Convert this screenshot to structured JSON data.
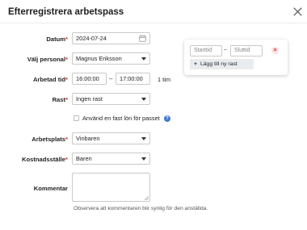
{
  "dialog": {
    "title": "Efterregistrera arbetspass",
    "close_icon": "close-icon"
  },
  "form": {
    "datum": {
      "label": "Datum",
      "required_mark": "*",
      "value": "2024-07-24",
      "icon": "calendar-icon"
    },
    "personal": {
      "label": "Välj personal",
      "required_mark": "*",
      "value": "Magnus Eriksson"
    },
    "arbetad_tid": {
      "label": "Arbetad tid",
      "required_mark": "*",
      "start": "16:00:00",
      "separator": "–",
      "end": "17:00:00",
      "duration": "1 tim"
    },
    "rast": {
      "label": "Rast",
      "required_mark": "*",
      "value": "Ingen rast"
    },
    "fast_lon": {
      "label": "Använd en fast lön för passet",
      "checked": false,
      "help_icon": "question-icon",
      "help_glyph": "?"
    },
    "arbetsplats": {
      "label": "Arbetsplats",
      "required_mark": "*",
      "value": "Vinbaren"
    },
    "kostnadsstalle": {
      "label": "Kostnadsställe",
      "required_mark": "*",
      "value": "Baren"
    },
    "kommentar": {
      "label": "Kommentar",
      "value": "",
      "hint": "Observera att kommentaren blir synlig för den anställda."
    }
  },
  "break_card": {
    "start_placeholder": "Starttid",
    "separator": "–",
    "end_placeholder": "Sluttid",
    "remove_glyph": "×",
    "add_button": {
      "plus": "+",
      "label": "Lägg till ny rast"
    }
  },
  "colors": {
    "required": "#d63030",
    "help": "#3d7ccc",
    "remove_bg": "#fde2e2"
  }
}
